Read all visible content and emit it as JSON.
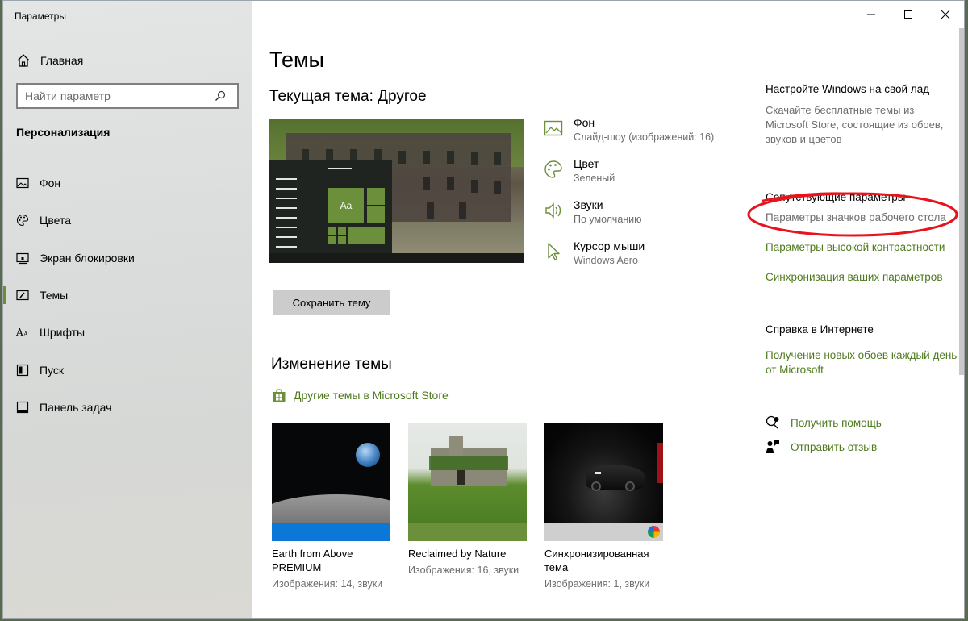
{
  "window": {
    "title": "Параметры"
  },
  "sidebar": {
    "home": "Главная",
    "search_placeholder": "Найти параметр",
    "section": "Персонализация",
    "items": [
      {
        "label": "Фон",
        "icon": "picture-icon"
      },
      {
        "label": "Цвета",
        "icon": "palette-icon"
      },
      {
        "label": "Экран блокировки",
        "icon": "lock-screen-icon"
      },
      {
        "label": "Темы",
        "icon": "brush-icon",
        "active": true
      },
      {
        "label": "Шрифты",
        "icon": "font-icon"
      },
      {
        "label": "Пуск",
        "icon": "start-icon"
      },
      {
        "label": "Панель задач",
        "icon": "taskbar-icon"
      }
    ]
  },
  "main": {
    "title": "Темы",
    "current_theme_label": "Текущая тема: Другое",
    "properties": [
      {
        "name": "Фон",
        "value": "Слайд-шоу (изображений: 16)",
        "icon": "picture-icon"
      },
      {
        "name": "Цвет",
        "value": "Зеленый",
        "icon": "palette-icon"
      },
      {
        "name": "Звуки",
        "value": "По умолчанию",
        "icon": "speaker-icon"
      },
      {
        "name": "Курсор мыши",
        "value": "Windows Aero",
        "icon": "cursor-icon"
      }
    ],
    "preview_tile_text": "Aa",
    "save_button": "Сохранить тему",
    "change_title": "Изменение темы",
    "store_link": "Другие темы в Microsoft Store",
    "themes": [
      {
        "name": "Earth from Above PREMIUM",
        "meta": "Изображения: 14, звуки",
        "bar_color": "#0b78d7"
      },
      {
        "name": "Reclaimed by Nature",
        "meta": "Изображения: 16, звуки",
        "bar_color": "#6b8f3a"
      },
      {
        "name": "Синхронизированная тема",
        "meta": "Изображения: 1, звуки",
        "bar_color": "#cfcfcf"
      }
    ]
  },
  "right": {
    "customize_title": "Настройте Windows на свой лад",
    "customize_text": "Скачайте бесплатные темы из Microsoft Store, состоящие из обоев, звуков и цветов",
    "related_title": "Сопутствующие параметры",
    "related_links": [
      "Параметры значков рабочего стола",
      "Параметры высокой контрастности",
      "Синхронизация ваших параметров"
    ],
    "web_help_title": "Справка в Интернете",
    "web_help_link": "Получение новых обоев каждый день от Microsoft",
    "get_help": "Получить помощь",
    "feedback": "Отправить отзыв"
  },
  "colors": {
    "accent": "#6b8f3a",
    "link": "#4e7a1d",
    "annotation": "#e8141c"
  }
}
